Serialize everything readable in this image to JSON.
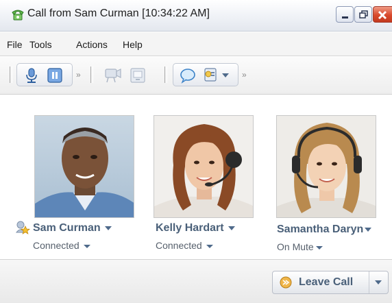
{
  "window": {
    "title": "Call from Sam Curman [10:34:22 AM]"
  },
  "menu": {
    "items": [
      "File",
      "Tools",
      "Actions",
      "Help"
    ]
  },
  "toolbar": {
    "icons": [
      "microphone-icon",
      "pause-icon",
      "video-icon",
      "screen-share-icon",
      "chat-icon",
      "contacts-icon"
    ]
  },
  "participants": [
    {
      "name": "Sam Curman",
      "status": "Connected",
      "role_icon": "moderator-star-icon"
    },
    {
      "name": "Kelly Hardart",
      "status": "Connected"
    },
    {
      "name": "Samantha Daryn",
      "status": "On Mute"
    }
  ],
  "footer": {
    "leave_label": "Leave Call"
  },
  "colors": {
    "name_text": "#4a6079",
    "close_button": "#d8492c",
    "accent": "#2f7bd6"
  }
}
